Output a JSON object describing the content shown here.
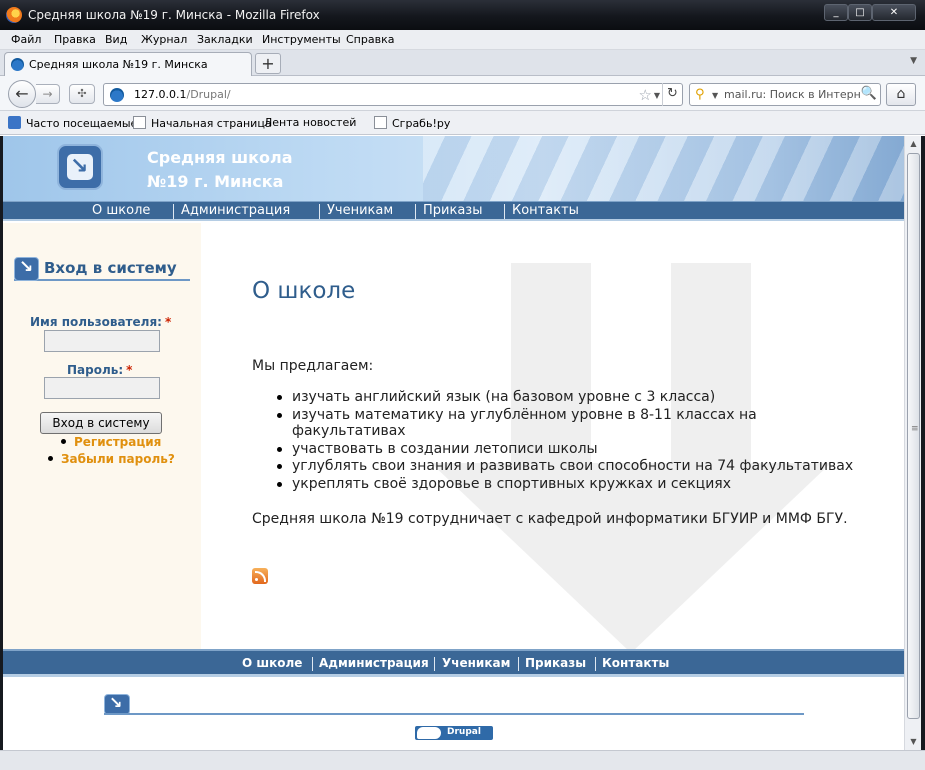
{
  "window": {
    "title": "Средняя школа №19 г. Минска - Mozilla Firefox",
    "minimize": "_",
    "maximize": "□",
    "close": "✕"
  },
  "menu": [
    "Файл",
    "Правка",
    "Вид",
    "Журнал",
    "Закладки",
    "Инструменты",
    "Справка"
  ],
  "tab": {
    "label": "Средняя школа №19 г. Минска",
    "close": "×",
    "new_tab": "+"
  },
  "address": {
    "host": "127.0.0.1",
    "path": "/Drupal/"
  },
  "search": {
    "placeholder": "mail.ru: Поиск в Интернете"
  },
  "bookmarks": [
    "Часто посещаемые",
    "Начальная страница",
    "Лента новостей",
    "Сграбь!ру"
  ],
  "site": {
    "name_line1": "Средняя школа",
    "name_line2": "№19 г. Минска"
  },
  "nav": [
    "О школе",
    "Администрация",
    "Ученикам",
    "Приказы",
    "Контакты"
  ],
  "login": {
    "title": "Вход в систему",
    "username_label": "Имя пользователя:",
    "password_label": "Пароль:",
    "required_mark": "*",
    "username_value": "",
    "password_value": "",
    "submit": "Вход в систему",
    "links": [
      "Регистрация",
      "Забыли пароль?"
    ]
  },
  "content": {
    "title": "О школе",
    "lead": "Мы предлагаем:",
    "items": [
      "изучать английский язык (на базовом уровне с 3 класса)",
      "изучать математику на углублённом уровне в 8-11 классах на факультативах",
      "участвовать в создании летописи школы",
      "углублять свои знания и развивать свои способности на 74 факультативах",
      "укреплять своё здоровье в спортивных кружках и секциях"
    ],
    "paragraph": "Средняя школа №19 сотрудничает с кафедрой информатики БГУИР и ММФ БГУ."
  },
  "footer": {
    "nav": [
      "О школе",
      "Администрация",
      "Ученикам",
      "Приказы",
      "Контакты"
    ],
    "badge": "Drupal"
  },
  "icons": {
    "logo": "site-logo-arrow-icon",
    "block": "login-block-icon",
    "feed": "rss-feed-icon"
  },
  "colors": {
    "nav_bg": "#3b6796",
    "title": "#2f5d8c",
    "link": "#e0900f",
    "sidebar_bg": "#fdf8ee"
  }
}
